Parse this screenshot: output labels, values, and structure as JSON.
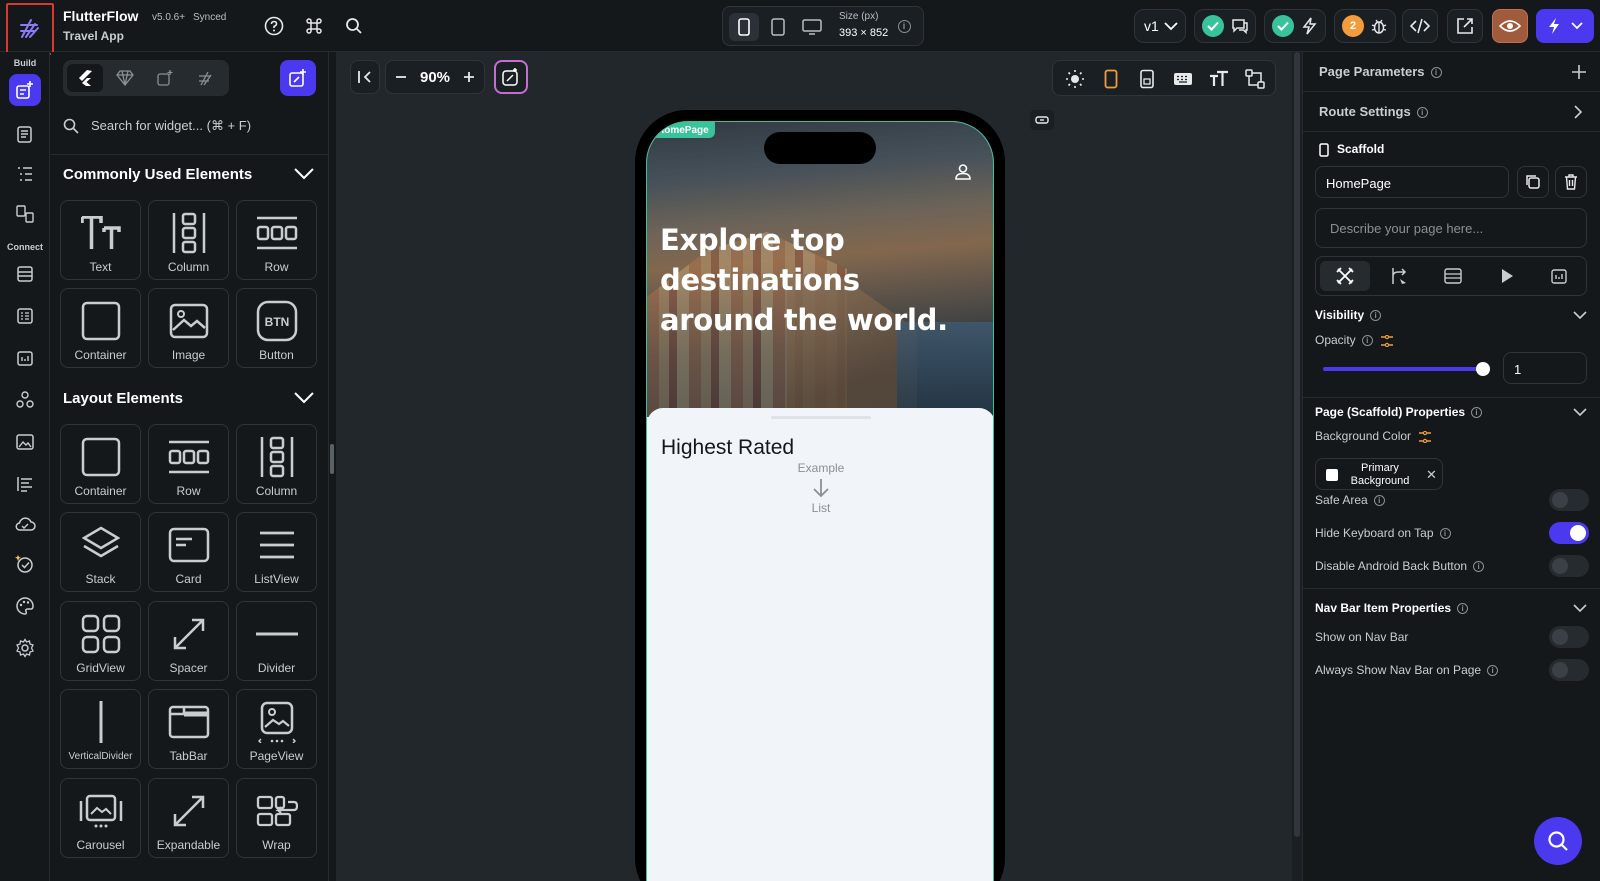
{
  "app": {
    "name": "FlutterFlow",
    "version": "v5.0.6+",
    "sync_status": "Synced",
    "project": "Travel App"
  },
  "device": {
    "size_label": "Size (px)",
    "size_value": "393 × 852"
  },
  "header": {
    "version_select": "v1",
    "warning_count": "2"
  },
  "rail": {
    "build_label": "Build",
    "connect_label": "Connect"
  },
  "widgets": {
    "search_placeholder": "Search for widget... (⌘ + F)",
    "common_title": "Commonly Used Elements",
    "common": [
      "Text",
      "Column",
      "Row",
      "Container",
      "Image",
      "Button"
    ],
    "layout_title": "Layout Elements",
    "layout": [
      "Container",
      "Row",
      "Column",
      "Stack",
      "Card",
      "ListView",
      "GridView",
      "Spacer",
      "Divider",
      "VerticalDivider",
      "TabBar",
      "PageView",
      "Carousel",
      "Expandable",
      "Wrap"
    ]
  },
  "canvas": {
    "zoom": "90%"
  },
  "phone": {
    "page_tag": "HomePage",
    "hero_title": "Explore top destinations around the world.",
    "section_title": "Highest Rated",
    "placeholder_top": "Example",
    "placeholder_bottom": "List"
  },
  "right": {
    "page_parameters": "Page Parameters",
    "route_settings": "Route Settings",
    "scaffold": "Scaffold",
    "page_name": "HomePage",
    "describe_placeholder": "Describe your page here...",
    "visibility": "Visibility",
    "opacity_label": "Opacity",
    "opacity_value": "1",
    "opacity_fraction": 1,
    "scaffold_props": "Page (Scaffold) Properties",
    "bg_color_label": "Background Color",
    "bg_color_value": "Primary Background",
    "safe_area": "Safe Area",
    "safe_area_on": false,
    "hide_keyboard": "Hide Keyboard on Tap",
    "hide_keyboard_on": true,
    "disable_back": "Disable Android Back Button",
    "disable_back_on": false,
    "nav_props": "Nav Bar Item Properties",
    "show_nav": "Show on Nav Bar",
    "show_nav_on": false,
    "always_show_nav": "Always Show Nav Bar on Page",
    "always_show_nav_on": false
  },
  "colors": {
    "accent": "#4b39ef",
    "success": "#39c39a",
    "warning": "#f29c3c",
    "highlight_border": "#d9382c"
  }
}
